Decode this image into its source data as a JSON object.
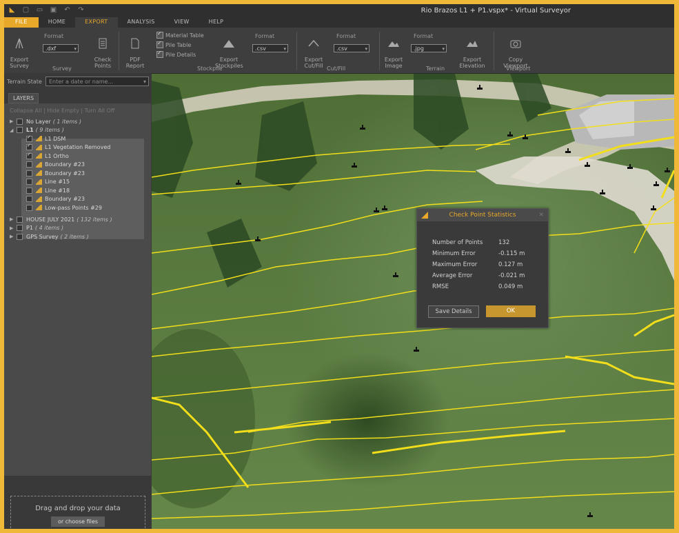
{
  "window": {
    "title": "Rio Brazos L1 + P1.vspx* - Virtual Surveyor"
  },
  "tabs": [
    {
      "label": "FILE"
    },
    {
      "label": "HOME"
    },
    {
      "label": "EXPORT"
    },
    {
      "label": "ANALYSIS"
    },
    {
      "label": "VIEW"
    },
    {
      "label": "HELP"
    }
  ],
  "ribbon": {
    "survey": {
      "group": "Survey",
      "export_label": "Export\nSurvey",
      "format_label": "Format",
      "format_value": ".dxf",
      "check_points": "Check\nPoints"
    },
    "stockpile": {
      "group": "Stockpile",
      "pdf_report": "PDF\nReport",
      "material_table": "Material Table",
      "pile_table": "Pile Table",
      "pile_details": "Pile Details",
      "export_stockpiles": "Export\nStockpiles",
      "format_label": "Format",
      "format_value": ".csv"
    },
    "cutfill": {
      "group": "Cut/Fill",
      "export_label": "Export\nCut/Fill",
      "format_label": "Format",
      "format_value": ".csv"
    },
    "terrain": {
      "group": "Terrain",
      "export_image": "Export\nImage",
      "format_label": "Format",
      "format_value": ".jpg",
      "export_elevation": "Export\nElevation"
    },
    "viewport": {
      "group": "Viewport",
      "copy_viewport": "Copy\nViewport"
    }
  },
  "left": {
    "terrain_state_label": "Terrain State",
    "terrain_placeholder": "Enter a date or name...",
    "layers_tab": "LAYERS",
    "layer_actions": "Collapse All   |   Hide Empty   |   Turn All Off",
    "layers": [
      {
        "name": "No Layer",
        "sub": "( 1 items )",
        "level": 0,
        "checked": false
      },
      {
        "name": "L1",
        "sub": "( 9 items )",
        "level": 0,
        "checked": false
      },
      {
        "name": "L1 DSM",
        "level": 1,
        "checked": true
      },
      {
        "name": "L1 Vegetation Removed",
        "level": 1,
        "checked": true
      },
      {
        "name": "L1 Ortho",
        "level": 1,
        "checked": true
      },
      {
        "name": "Boundary #23",
        "level": 1,
        "checked": false
      },
      {
        "name": "Boundary #23",
        "level": 1,
        "checked": false
      },
      {
        "name": "Line #15",
        "level": 1,
        "checked": false
      },
      {
        "name": "Line #18",
        "level": 1,
        "checked": false
      },
      {
        "name": "Boundary #23",
        "level": 1,
        "checked": false
      },
      {
        "name": "Low-pass Points #29",
        "level": 1,
        "checked": false
      },
      {
        "name": "HOUSE JULY 2021",
        "sub": "( 132 items )",
        "level": 0,
        "checked": false
      },
      {
        "name": "P1",
        "sub": "( 4 items )",
        "level": 0,
        "checked": false
      },
      {
        "name": "GPS Survey",
        "sub": "( 2 items )",
        "level": 0,
        "checked": false
      }
    ],
    "drop": {
      "title": "Drag and drop your data",
      "button": "or choose files"
    }
  },
  "dialog": {
    "title": "Check Point Statistics",
    "stats": [
      {
        "label": "Number of Points",
        "value": "132"
      },
      {
        "label": "Minimum Error",
        "value": "-0.115 m"
      },
      {
        "label": "Maximum Error",
        "value": "0.127 m"
      },
      {
        "label": "Average Error",
        "value": "-0.021 m"
      },
      {
        "label": "RMSE",
        "value": "0.049 m"
      }
    ],
    "save_button": "Save Details",
    "ok_button": "OK"
  },
  "colors": {
    "accent": "#e8a82a",
    "contour": "#f2de1a",
    "background_frame": "#f0b838"
  }
}
